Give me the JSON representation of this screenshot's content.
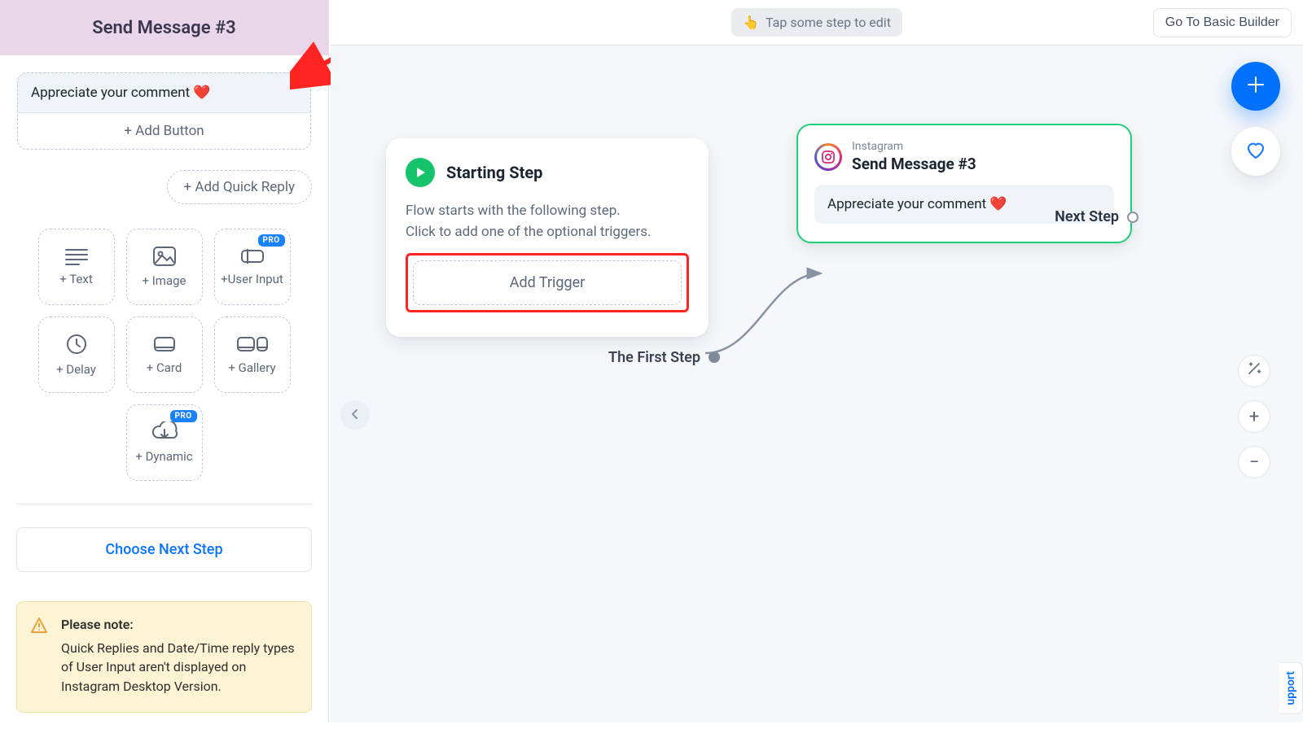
{
  "sidebar": {
    "title": "Send Message #3",
    "message_text": "Appreciate your comment ❤️",
    "add_button_label": "+ Add Button",
    "add_quick_reply_label": "+ Add Quick Reply",
    "tools": {
      "text": "+ Text",
      "image": "+ Image",
      "user_input": "+User Input",
      "delay": "+ Delay",
      "card": "+ Card",
      "gallery": "+ Gallery",
      "dynamic": "+ Dynamic"
    },
    "pro_badge": "PRO",
    "choose_next_label": "Choose Next Step",
    "note_title": "Please note:",
    "note_body": "Quick Replies and Date/Time reply types of User Input aren't displayed on Instagram Desktop Version."
  },
  "topbar": {
    "hint": "Tap some step to edit",
    "hint_emoji": "👆",
    "goto_label": "Go To Basic Builder"
  },
  "nodes": {
    "start": {
      "title": "Starting Step",
      "line1": "Flow starts with the following step.",
      "line2": "Click to add one of the optional triggers.",
      "add_trigger_label": "Add Trigger",
      "first_step_label": "The First Step"
    },
    "ig": {
      "channel": "Instagram",
      "title": "Send Message #3",
      "bubble": "Appreciate your comment ❤️",
      "next_step_label": "Next Step"
    }
  },
  "support_tab": "upport"
}
